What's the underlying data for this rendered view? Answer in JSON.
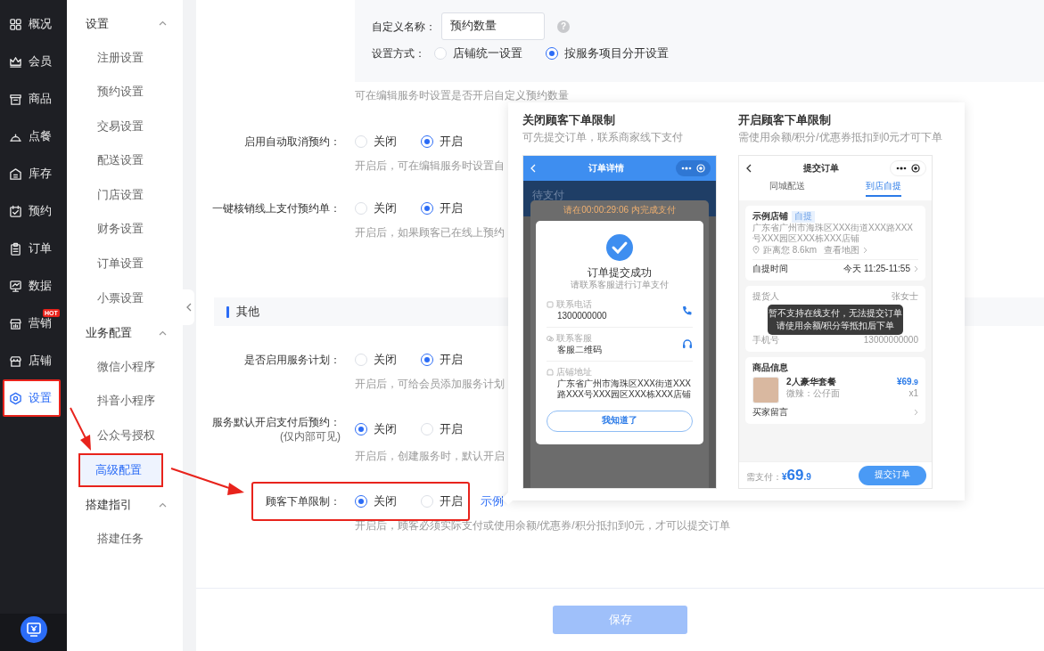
{
  "main_nav": [
    {
      "label": "概况",
      "selected": false,
      "annotated": false
    },
    {
      "label": "会员",
      "selected": false,
      "annotated": false
    },
    {
      "label": "商品",
      "selected": false,
      "annotated": false
    },
    {
      "label": "点餐",
      "selected": false,
      "annotated": false
    },
    {
      "label": "库存",
      "selected": false,
      "annotated": false
    },
    {
      "label": "预约",
      "selected": false,
      "annotated": false
    },
    {
      "label": "订单",
      "selected": false,
      "annotated": false
    },
    {
      "label": "数据",
      "selected": false,
      "annotated": false
    },
    {
      "label": "营销",
      "selected": false,
      "annotated": false,
      "badge": "HOT"
    },
    {
      "label": "店铺",
      "selected": false,
      "annotated": false
    },
    {
      "label": "设置",
      "selected": true,
      "annotated": true
    }
  ],
  "sub_nav": [
    {
      "title": "设置",
      "expanded": true,
      "items": [
        {
          "label": "注册设置",
          "selected": false,
          "annotated": false
        },
        {
          "label": "预约设置",
          "selected": false,
          "annotated": false
        },
        {
          "label": "交易设置",
          "selected": false,
          "annotated": false
        },
        {
          "label": "配送设置",
          "selected": false,
          "annotated": false
        },
        {
          "label": "门店设置",
          "selected": false,
          "annotated": false
        },
        {
          "label": "财务设置",
          "selected": false,
          "annotated": false
        },
        {
          "label": "订单设置",
          "selected": false,
          "annotated": false
        },
        {
          "label": "小票设置",
          "selected": false,
          "annotated": false
        }
      ]
    },
    {
      "title": "业务配置",
      "expanded": true,
      "items": [
        {
          "label": "微信小程序",
          "selected": false,
          "annotated": false
        },
        {
          "label": "抖音小程序",
          "selected": false,
          "annotated": false
        },
        {
          "label": "公众号授权",
          "selected": false,
          "annotated": false
        },
        {
          "label": "高级配置",
          "selected": true,
          "annotated": true
        }
      ]
    },
    {
      "title": "搭建指引",
      "expanded": true,
      "items": [
        {
          "label": "搭建任务",
          "selected": false,
          "annotated": false
        }
      ]
    }
  ],
  "custom_count": {
    "name_label": "自定义名称：",
    "name_value": "预约数量",
    "help": "?",
    "mode_label": "设置方式：",
    "options": [
      {
        "label": "店铺统一设置",
        "selected": false
      },
      {
        "label": "按服务项目分开设置",
        "selected": true
      }
    ],
    "hint": "可在编辑服务时设置是否开启自定义预约数量"
  },
  "booking_settings": [
    {
      "label": "启用自动取消预约：",
      "options": [
        {
          "label": "关闭",
          "selected": false
        },
        {
          "label": "开启",
          "selected": true
        }
      ],
      "hint": "开启后，可在编辑服务时设置自",
      "annotated": false
    },
    {
      "label": "一键核销线上支付预约单：",
      "options": [
        {
          "label": "关闭",
          "selected": false
        },
        {
          "label": "开启",
          "selected": true
        }
      ],
      "hint": "开启后，如果顾客已在线上预约",
      "annotated": false
    }
  ],
  "other_section": {
    "title": "其他",
    "settings": [
      {
        "label": "是否启用服务计划：",
        "options": [
          {
            "label": "关闭",
            "selected": false
          },
          {
            "label": "开启",
            "selected": true
          }
        ],
        "hint": "开启后，可给会员添加服务计划",
        "annotated": false
      },
      {
        "label": "服务默认开启支付后预约：",
        "sublabel": "(仅内部可见)",
        "options": [
          {
            "label": "关闭",
            "selected": true
          },
          {
            "label": "开启",
            "selected": false
          }
        ],
        "hint": "开启后，创建服务时，默认开启",
        "annotated": false
      },
      {
        "label": "顾客下单限制：",
        "options": [
          {
            "label": "关闭",
            "selected": true
          },
          {
            "label": "开启",
            "selected": false
          }
        ],
        "link": "示例",
        "hint": "开启后，顾客必须实际支付或使用余额/优惠券/积分抵扣到0元，才可以提交订单",
        "annotated": true
      }
    ]
  },
  "example_popover": {
    "panels": [
      {
        "title": "关闭顾客下单限制",
        "subtitle": "可先提交订单，联系商家线下支付",
        "phone": {
          "kind": "order_success",
          "header_title": "订单详情",
          "status": "待支付",
          "countdown": "请在00:00:29:06 内完成支付",
          "dialog_title": "订单提交成功",
          "dialog_subtitle": "请联系客服进行订单支付",
          "contacts": [
            {
              "label": "联系电话",
              "value": "1300000000"
            },
            {
              "label": "联系客服",
              "value": "客服二维码"
            },
            {
              "label": "店铺地址",
              "value": "广东省广州市海珠区XXX街道XXX路XXX号XXX园区XXX栋XXX店铺"
            }
          ],
          "button": "我知道了"
        }
      },
      {
        "title": "开启顾客下单限制",
        "subtitle": "需使用余额/积分/优惠券抵扣到0元才可下单",
        "phone": {
          "kind": "submit_order",
          "header_title": "提交订单",
          "tabs": [
            {
              "label": "同城配送",
              "selected": false
            },
            {
              "label": "到店自提",
              "selected": true
            }
          ],
          "store_name": "示例店铺",
          "store_tag": "自提",
          "store_address": "广东省广州市海珠区XXX街道XXX路XXX号XXX园区XXX栋XXX店铺",
          "distance": "距离您 8.6km",
          "map_link": "查看地图",
          "pickup_label": "自提时间",
          "pickup_value": "今天 11:25-11:55",
          "contact_rows": [
            {
              "label": "提货人",
              "value": "张女士"
            },
            {
              "label": "手机号",
              "value": "13000000000"
            }
          ],
          "toast": [
            "暂不支持在线支付，无法提交订单",
            "请使用余额/积分等抵扣后下单"
          ],
          "goods_title": "商品信息",
          "goods_name": "2人豪华套餐",
          "goods_spec": "微辣：公仔面",
          "currency": "¥",
          "goods_price_int": "69",
          "goods_price_dec": ".9",
          "goods_qty": "x1",
          "note_label": "买家留言",
          "pay_label": "需支付：",
          "total_int": "69",
          "total_dec": ".9",
          "submit": "提交订单"
        }
      }
    ]
  },
  "footer": {
    "save_button": "保存",
    "disabled": true
  }
}
